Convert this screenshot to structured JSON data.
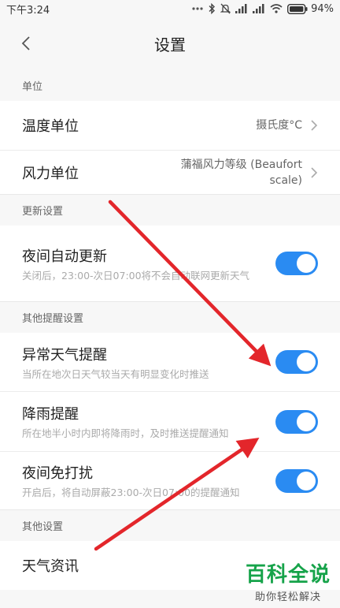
{
  "status_bar": {
    "time": "下午3:24",
    "battery_percent": "94%"
  },
  "header": {
    "title": "设置"
  },
  "sections": {
    "units": {
      "label": "单位",
      "items": [
        {
          "title": "温度单位",
          "value": "摄氏度°C"
        },
        {
          "title": "风力单位",
          "value": "蒲福风力等级 (Beaufort scale)"
        }
      ]
    },
    "update": {
      "label": "更新设置",
      "items": [
        {
          "title": "夜间自动更新",
          "desc": "关闭后，23:00-次日07:00将不会自动联网更新天气",
          "enabled": true
        }
      ]
    },
    "alerts": {
      "label": "其他提醒设置",
      "items": [
        {
          "title": "异常天气提醒",
          "desc": "当所在地次日天气较当天有明显变化时推送",
          "enabled": true
        },
        {
          "title": "降雨提醒",
          "desc": "所在地半小时内即将降雨时，及时推送提醒通知",
          "enabled": true
        },
        {
          "title": "夜间免打扰",
          "desc": "开启后，将自动屏蔽23:00-次日07:00的提醒通知",
          "enabled": true
        }
      ]
    },
    "other": {
      "label": "其他设置",
      "items": [
        {
          "title": "天气资讯"
        }
      ]
    }
  },
  "watermark": {
    "main": "百科全说",
    "sub": "助你轻松解决"
  },
  "colors": {
    "toggle_on": "#2a8bf2",
    "annotation_arrow": "#e3262b",
    "watermark": "#16a34a"
  }
}
